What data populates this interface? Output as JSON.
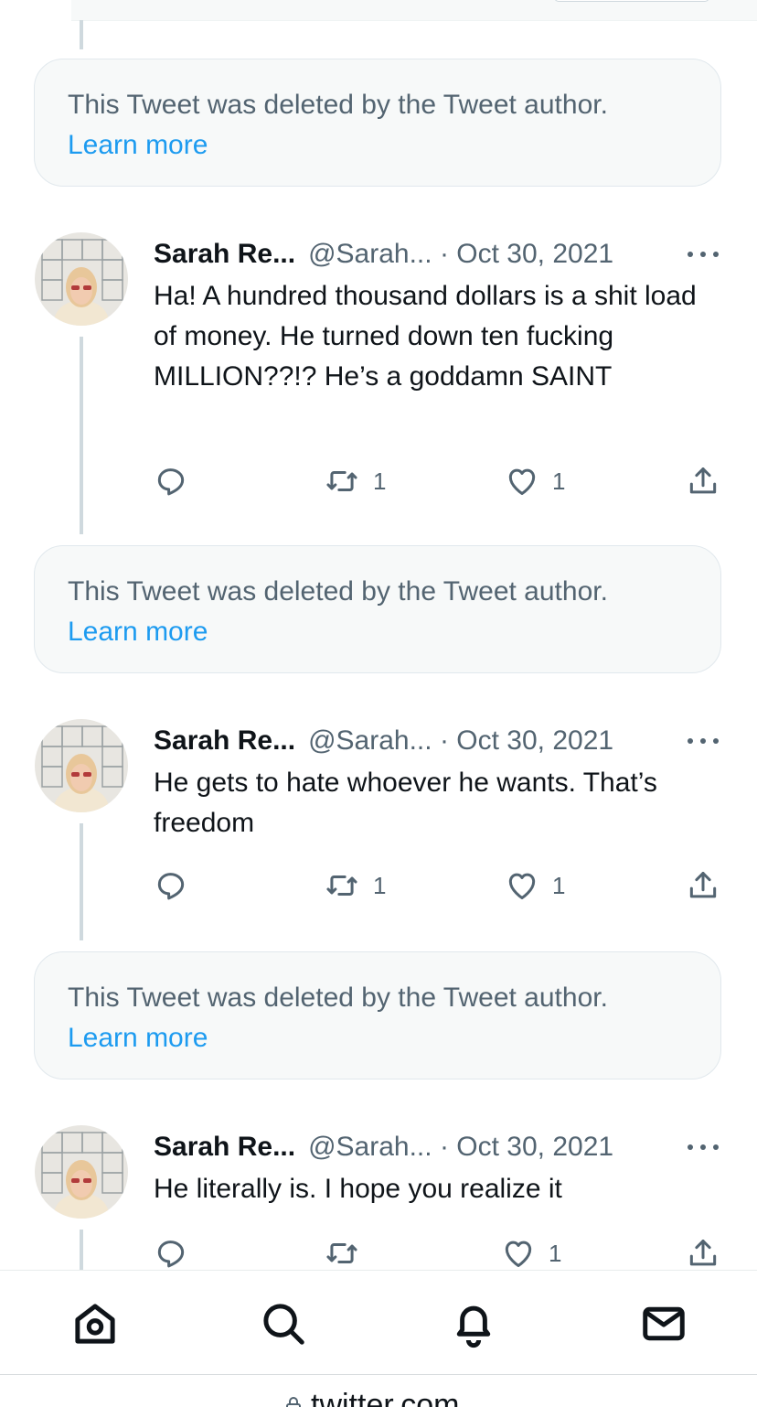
{
  "deleted_notice": {
    "text": "This Tweet was deleted by the Tweet author.",
    "link": "Learn more"
  },
  "tweets": [
    {
      "name": "Sarah Re...",
      "handle": "@Sarah...",
      "separator": "·",
      "date": "Oct 30, 2021",
      "text": "Ha! A hundred thousand dollars is a shit load of money. He turned down ten fucking MILLION??!? He’s a goddamn SAINT",
      "reply_count": "",
      "retweet_count": "1",
      "like_count": "1"
    },
    {
      "name": "Sarah Re...",
      "handle": "@Sarah...",
      "separator": "·",
      "date": "Oct 30, 2021",
      "text": "He gets to hate whoever he wants. That’s freedom",
      "reply_count": "",
      "retweet_count": "1",
      "like_count": "1"
    },
    {
      "name": "Sarah Re...",
      "handle": "@Sarah...",
      "separator": "·",
      "date": "Oct 30, 2021",
      "text": "He literally is. I hope you realize it",
      "reply_count": "",
      "retweet_count": "",
      "like_count": "1"
    }
  ],
  "tabbar": {
    "items": [
      "home-icon",
      "search-icon",
      "notifications-icon",
      "messages-icon"
    ]
  },
  "url_bar": {
    "url": "twitter.com"
  },
  "colors": {
    "accent": "#1d9bf0",
    "secondary_text": "#536471",
    "primary_text": "#0f1419",
    "deleted_bg": "#f7f9f9"
  }
}
